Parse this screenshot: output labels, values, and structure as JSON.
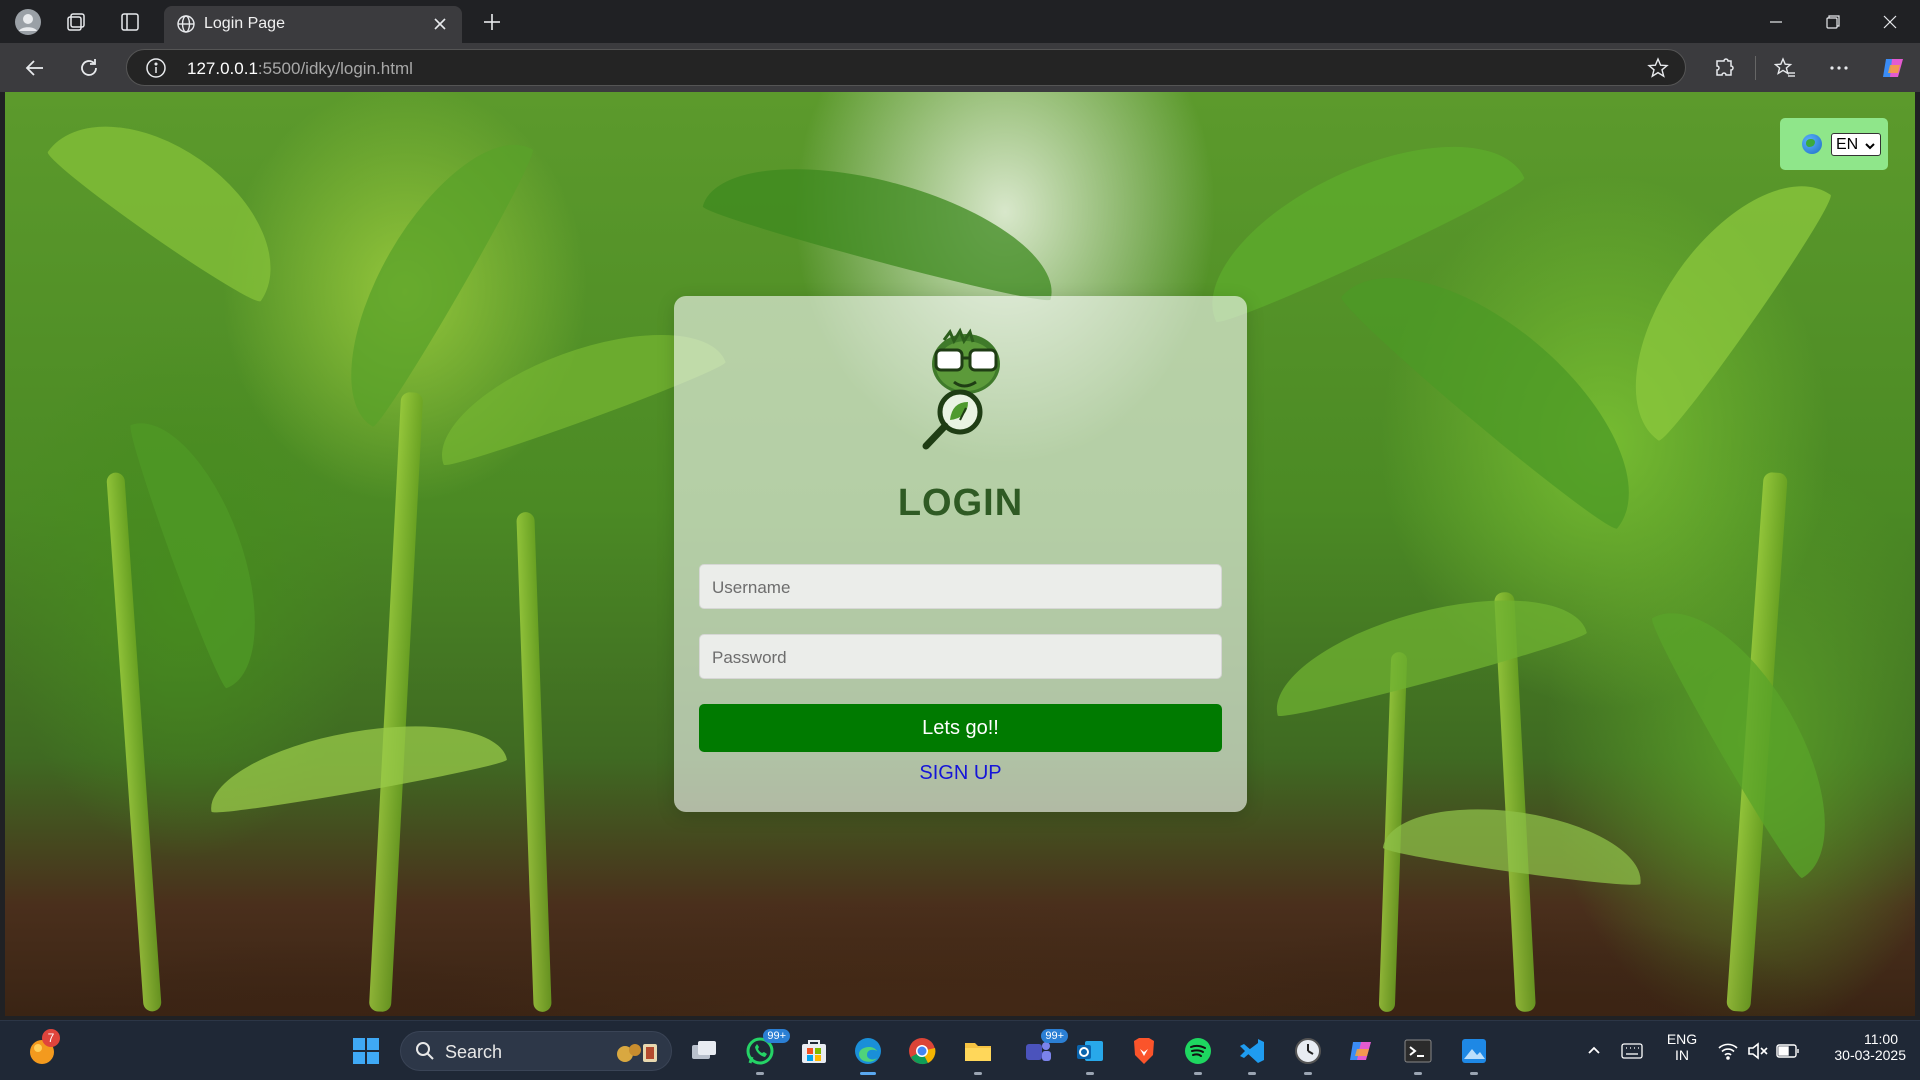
{
  "browser": {
    "tab_title": "Login Page",
    "url_host": "127.0.0.1",
    "url_rest": ":5500/idky/login.html"
  },
  "page": {
    "language_selected": "EN",
    "login_title": "LOGIN",
    "username_placeholder": "Username",
    "password_placeholder": "Password",
    "submit_label": "Lets go!!",
    "signup_label": "SIGN UP",
    "colors": {
      "submit_button": "#007a00",
      "title_text": "#2f5a24",
      "signup_link": "#1515d8",
      "language_box": "#8fe68a"
    }
  },
  "taskbar": {
    "search_label": "Search",
    "notification_count": "7",
    "whatsapp_badge": "99+",
    "teams_badge": "99+",
    "lang_line1": "ENG",
    "lang_line2": "IN",
    "time": "11:00",
    "date": "30-03-2025"
  }
}
